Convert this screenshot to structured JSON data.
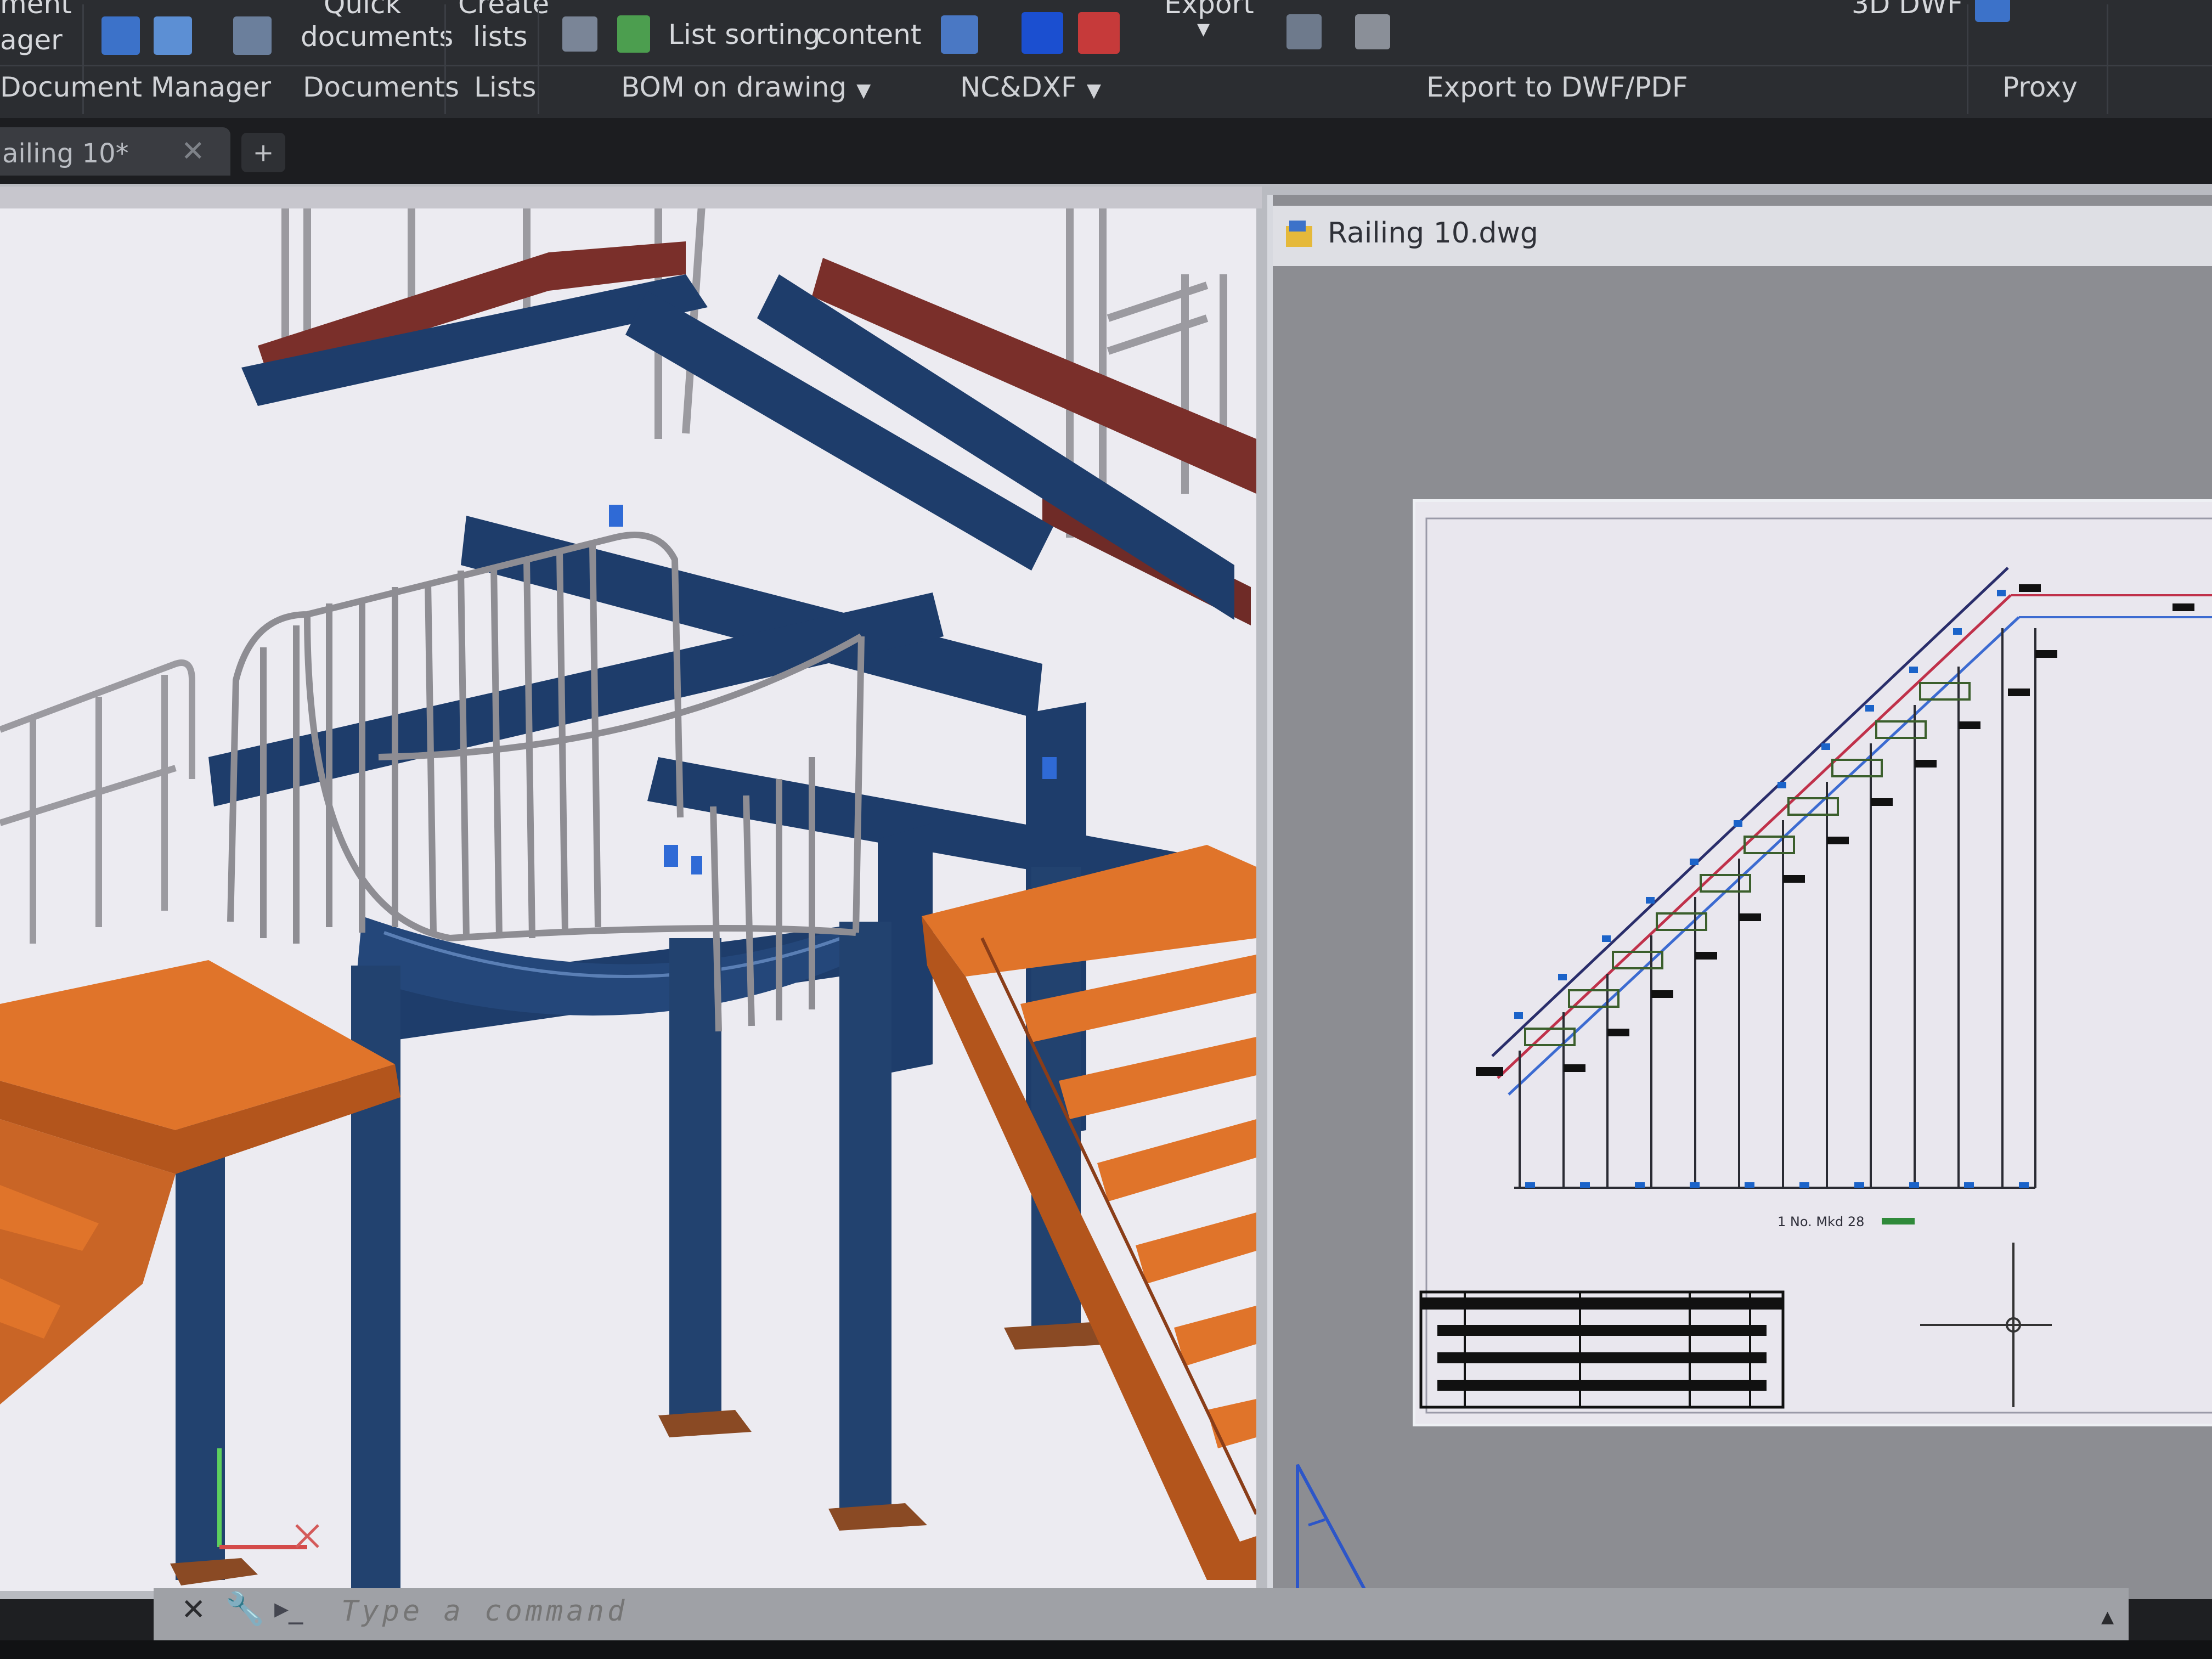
{
  "ribbon": {
    "top_labels": {
      "doc_manager_partial_1": "ment",
      "doc_manager_partial_2": "ager",
      "quick_1": "Quick",
      "quick_2": "documents",
      "create_1": "Create",
      "create_2": "lists",
      "list_sorting": "List sorting",
      "content": "content",
      "export": "Export",
      "dwf_partial": "3D DWF"
    },
    "panels": {
      "document_manager": "Document Manager",
      "documents": "Documents",
      "lists": "Lists",
      "bom_on_drawing": "BOM on drawing",
      "nc_dxf": "NC&DXF",
      "export_dwf_pdf": "Export to DWF/PDF",
      "proxy": "Proxy"
    }
  },
  "tabs": {
    "active_tab": "ailing 10*",
    "close_glyph": "✕",
    "new_tab_glyph": "+"
  },
  "preview": {
    "title": "Railing 10.dwg",
    "sheet_note": "1 No. Mkd 28"
  },
  "command_line": {
    "placeholder": "Type a command",
    "close_glyph": "✕",
    "prompt_glyph": "▸_"
  },
  "colors": {
    "steel_blue": "#1e3d6b",
    "grating_orange": "#e0742a",
    "railing_gray": "#9b9aa0",
    "beam_red": "#7a2f2a",
    "ribbon_bg": "#2b2d31"
  }
}
